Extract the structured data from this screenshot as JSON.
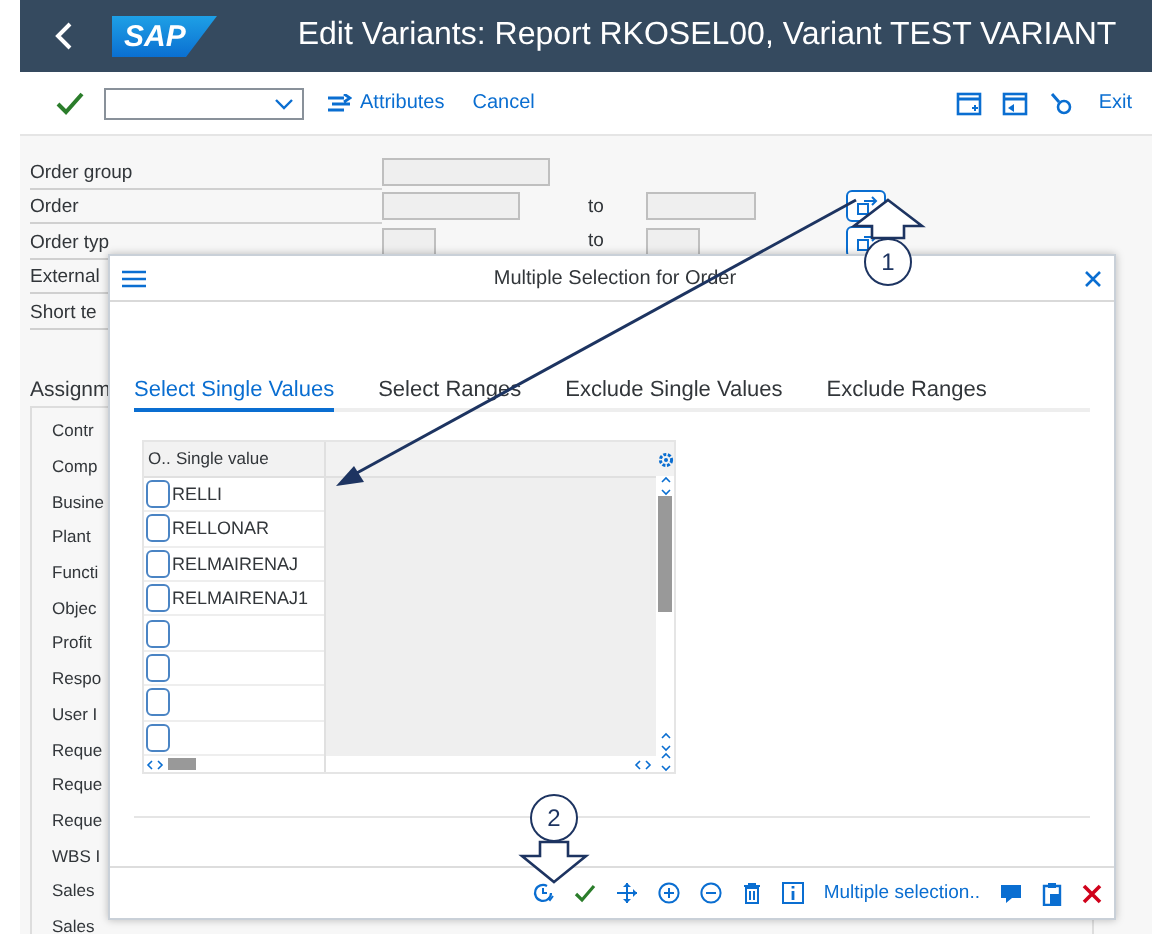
{
  "window": {
    "logo": "SAP",
    "title": "Edit Variants: Report RKOSEL00, Variant TEST VARIANT"
  },
  "toolbar": {
    "attributes": "Attributes",
    "cancel": "Cancel",
    "exit": "Exit"
  },
  "selection_fields": [
    {
      "label": "Order group",
      "kind": "single"
    },
    {
      "label": "Order",
      "kind": "range",
      "to": "to"
    },
    {
      "label": "Order typ",
      "kind": "range_short",
      "to": "to"
    },
    {
      "label": "External",
      "kind": "label_only"
    },
    {
      "label": "Short te",
      "kind": "label_only"
    }
  ],
  "assignments": {
    "title": "Assignm",
    "fields": [
      "Contr",
      "Comp",
      "Busine",
      "Plant",
      "Functi",
      "Objec",
      "Profit",
      "Respo",
      "User I",
      "Reque",
      "Reque",
      "Reque",
      "WBS I",
      "Sales",
      "Sales"
    ]
  },
  "dialog": {
    "title": "Multiple Selection for Order",
    "tabs": [
      {
        "label": "Select Single Values",
        "selected": true
      },
      {
        "label": "Select Ranges",
        "selected": false
      },
      {
        "label": "Exclude Single Values",
        "selected": false
      },
      {
        "label": "Exclude Ranges",
        "selected": false
      }
    ],
    "table": {
      "columns": [
        "O..",
        "Single value"
      ],
      "rows": [
        {
          "value": "RELLI",
          "checked": false
        },
        {
          "value": "RELLONAR",
          "checked": false
        },
        {
          "value": "RELMAIRENAJ",
          "checked": false
        },
        {
          "value": "RELMAIRENAJ1",
          "checked": false
        },
        {
          "checked": false
        },
        {
          "checked": false
        },
        {
          "checked": false
        },
        {
          "checked": false
        }
      ]
    },
    "footer": {
      "link": "Multiple selection.."
    }
  },
  "annotations": [
    {
      "number": "1",
      "kind": "up"
    },
    {
      "number": "2",
      "kind": "down"
    }
  ]
}
